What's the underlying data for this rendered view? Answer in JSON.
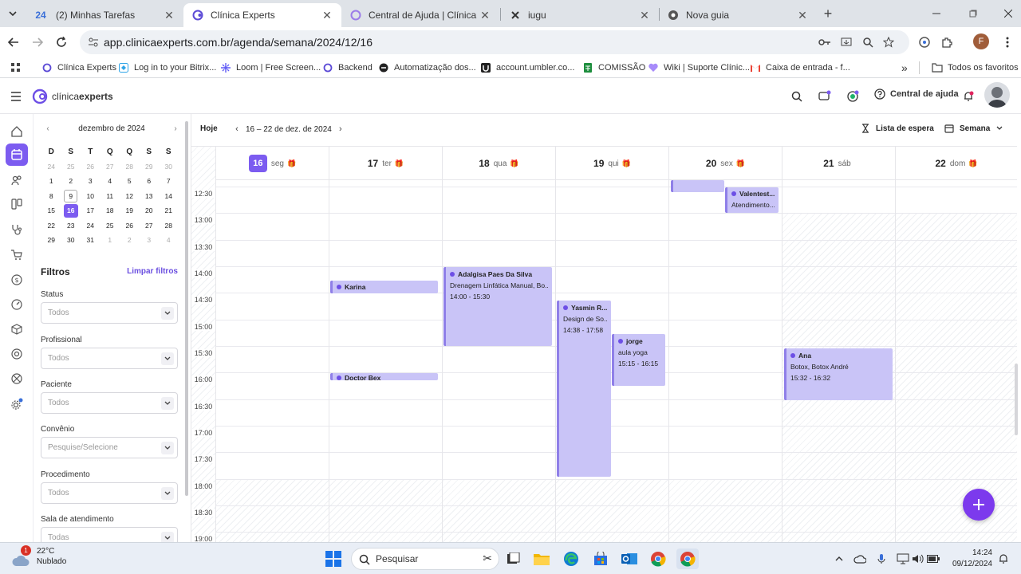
{
  "browser": {
    "tabs": [
      {
        "title": "(2) Minhas Tarefas",
        "badge": "24",
        "active": false
      },
      {
        "title": "Clínica Experts",
        "active": true
      },
      {
        "title": "Central de Ajuda | Clínica Exper",
        "active": false
      },
      {
        "title": "iugu",
        "active": false
      },
      {
        "title": "Nova guia",
        "active": false
      }
    ],
    "url": "app.clinicaexperts.com.br/agenda/semana/2024/12/16",
    "profile_initial": "F",
    "bookmarks": [
      "Clínica Experts",
      "Log in to your Bitrix...",
      "Loom | Free Screen...",
      "Backend",
      "Automatização dos...",
      "account.umbler.co...",
      "COMISSÃO",
      "Wiki | Suporte Clínic...",
      "Caixa de entrada - f..."
    ],
    "all_bookmarks": "Todos os favoritos"
  },
  "app": {
    "logo_light": "clínica",
    "logo_bold": "experts",
    "help": "Central de ajuda"
  },
  "sidebar": {
    "month_title": "dezembro de 2024",
    "weekday_headers": [
      "D",
      "S",
      "T",
      "Q",
      "Q",
      "S",
      "S"
    ],
    "weeks": [
      [
        "24",
        "25",
        "26",
        "27",
        "28",
        "29",
        "30"
      ],
      [
        "1",
        "2",
        "3",
        "4",
        "5",
        "6",
        "7"
      ],
      [
        "8",
        "9",
        "10",
        "11",
        "12",
        "13",
        "14"
      ],
      [
        "15",
        "16",
        "17",
        "18",
        "19",
        "20",
        "21"
      ],
      [
        "22",
        "23",
        "24",
        "25",
        "26",
        "27",
        "28"
      ],
      [
        "29",
        "30",
        "31",
        "1",
        "2",
        "3",
        "4"
      ]
    ],
    "filters_title": "Filtros",
    "clear_filters": "Limpar filtros",
    "filters": [
      {
        "label": "Status",
        "value": "Todos"
      },
      {
        "label": "Profissional",
        "value": "Todos"
      },
      {
        "label": "Paciente",
        "value": "Todos"
      },
      {
        "label": "Convênio",
        "value": "Pesquise/Selecione"
      },
      {
        "label": "Procedimento",
        "value": "Todos"
      },
      {
        "label": "Sala de atendimento",
        "value": "Todas"
      }
    ]
  },
  "calendar": {
    "today_label": "Hoje",
    "range": "16 – 22 de dez. de 2024",
    "waitlist": "Lista de espera",
    "view": "Semana",
    "days": [
      {
        "num": "16",
        "wd": "seg",
        "today": true,
        "gift": true
      },
      {
        "num": "17",
        "wd": "ter",
        "gift": true
      },
      {
        "num": "18",
        "wd": "qua",
        "gift": true
      },
      {
        "num": "19",
        "wd": "qui",
        "gift": true
      },
      {
        "num": "20",
        "wd": "sex",
        "gift": true
      },
      {
        "num": "21",
        "wd": "sáb",
        "gift": false
      },
      {
        "num": "22",
        "wd": "dom",
        "gift": true
      }
    ],
    "times": [
      "12:30",
      "13:00",
      "13:30",
      "14:00",
      "14:30",
      "15:00",
      "15:30",
      "16:00",
      "16:30",
      "17:00",
      "17:30",
      "18:00",
      "18:30",
      "19:00"
    ],
    "events": [
      {
        "name": "Karina"
      },
      {
        "name": "Doctor Bex"
      },
      {
        "name": "Adalgisa Paes Da Silva",
        "desc": "Drenagem Linfática Manual, Bo...",
        "time": "14:00 - 15:30"
      },
      {
        "name": "Yasmin R...",
        "desc": "Design de So...",
        "time": "14:38 - 17:58"
      },
      {
        "name": "jorge",
        "desc": "aula yoga",
        "time": "15:15 - 16:15"
      },
      {
        "name": "Valentest...",
        "desc": "Atendimento..."
      },
      {
        "name": "Ana",
        "desc": "Botox, Botox André",
        "time": "15:32 - 16:32"
      }
    ]
  },
  "taskbar": {
    "temp": "22°C",
    "weather": "Nublado",
    "weather_badge": "1",
    "search": "Pesquisar",
    "time": "14:24",
    "date": "09/12/2024"
  }
}
